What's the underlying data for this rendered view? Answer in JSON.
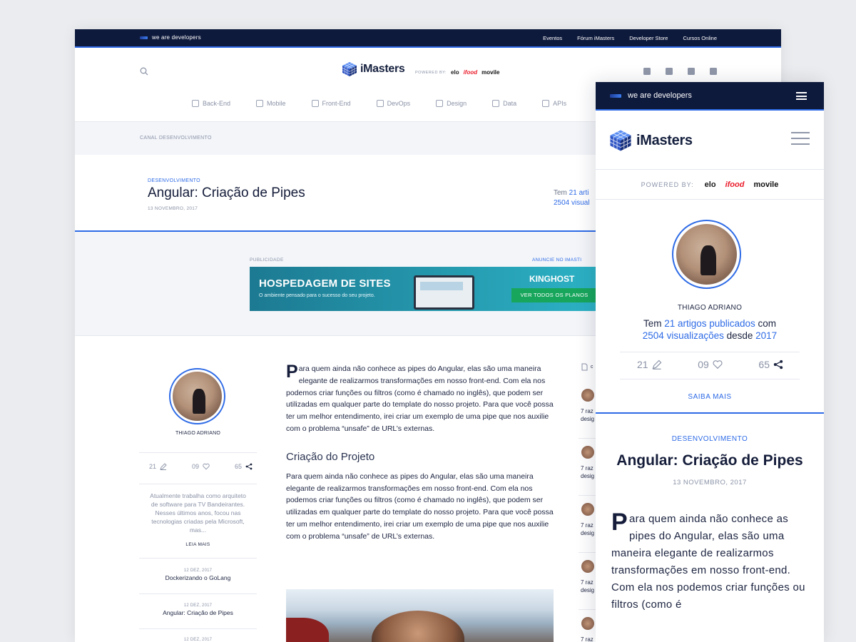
{
  "desktop": {
    "topbar": {
      "tagline": "we are developers",
      "links": [
        "Eventos",
        "Fórum iMasters",
        "Developer Store",
        "Cursos Online"
      ]
    },
    "header": {
      "logo_text": "iMasters",
      "powered_by": "POWERED BY:",
      "partners": [
        "elo",
        "ifood",
        "movile"
      ],
      "social": [
        "facebook-icon",
        "twitter-icon",
        "youtube-icon",
        "linkedin-icon"
      ],
      "categories": [
        "Back-End",
        "Mobile",
        "Front-End",
        "DevOps",
        "Design",
        "Data",
        "APIs"
      ]
    },
    "breadcrumb": "CANAL DESENVOLVIMENTO",
    "article_head": {
      "category": "DESENVOLVIMENTO",
      "title": "Angular: Criação de Pipes",
      "date": "13 NOVEMBRO, 2017",
      "stat_line1_prefix": "Tem ",
      "stat_line1_link": "21 arti",
      "stat_line2_link": "2504 visual"
    },
    "ad": {
      "label": "PUBLICIDADE",
      "advertise": "ANUNCIE NO IMASTI",
      "banner_title": "HOSPEDAGEM DE SITES",
      "banner_sub": "O ambiente pensado para o sucesso do seu projeto.",
      "banner_brand": "KINGHOST",
      "banner_cta": "VER TODOS OS PLANOS"
    },
    "author": {
      "name": "THIAGO ADRIANO",
      "articles": "21",
      "likes": "09",
      "shares": "65",
      "bio": "Atualmente trabalha como arquiteto de software para TV Bandeirantes. Nesses últimos anos, focou nas tecnologias criadas pela Microsoft, mas...",
      "read_more": "LEIA MAIS",
      "related": [
        {
          "date": "12 DEZ, 2017",
          "title": "Dockerizando o GoLang"
        },
        {
          "date": "12 DEZ, 2017",
          "title": "Angular: Criação de Pipes"
        },
        {
          "date": "12 DEZ, 2017",
          "title": ""
        }
      ]
    },
    "article": {
      "dropcap": "P",
      "intro": "ara quem ainda não conhece as pipes do Angular, elas são uma maneira elegante de realizarmos transformações em nosso front-end. Com ela nos podemos criar funções ou filtros (como é chamado no inglês), que podem ser utilizadas em qualquer parte do template do nosso projeto. Para que você possa ter um melhor entendimento, irei criar um exemplo de uma pipe que nos auxilie com o problema “unsafe” de URL’s externas.",
      "section_title": "Criação do Projeto",
      "section_text": "Para quem ainda não conhece as pipes do Angular, elas são uma maneira elegante de realizarmos transformações em nosso front-end. Com ela nos podemos criar funções ou filtros (como é chamado no inglês), que podem ser utilizadas em qualquer parte do template do nosso projeto. Para que você possa ter um melhor entendimento, irei criar um exemplo de uma pipe que nos auxilie com o problema “unsafe” de URL’s externas."
    },
    "rail": {
      "header": "c",
      "items": [
        {
          "l1": "7 raz",
          "l2": "desig"
        },
        {
          "l1": "7 raz",
          "l2": "desig"
        },
        {
          "l1": "7 raz",
          "l2": "desig"
        },
        {
          "l1": "7 raz",
          "l2": "desig"
        },
        {
          "l1": "7 raz",
          "l2": "desig"
        }
      ]
    }
  },
  "mobile": {
    "tagline": "we are developers",
    "logo_text": "iMasters",
    "powered_by": "POWERED BY:",
    "partners": [
      "elo",
      "ifood",
      "movile"
    ],
    "author": {
      "name": "THIAGO ADRIANO",
      "stat_prefix": "Tem ",
      "stat_link1": "21 artigos publicados",
      "stat_mid": " com",
      "stat_link2": "2504 visualizações",
      "stat_mid2": " desde ",
      "stat_link3": "2017",
      "articles": "21",
      "likes": "09",
      "shares": "65",
      "more": "SAIBA MAIS"
    },
    "article": {
      "category": "DESENVOLVIMENTO",
      "title": "Angular: Criação de Pipes",
      "date": "13 NOVEMBRO, 2017",
      "dropcap": "P",
      "intro": "ara quem ainda não conhece as pipes do Angular, elas são uma maneira elegante de realizarmos transformações em nosso front-end. Com ela nos podemos criar funções ou filtros (como é"
    }
  },
  "colors": {
    "navy": "#0e1a3c",
    "accent": "#2e6be6",
    "muted": "#8a92a6"
  }
}
